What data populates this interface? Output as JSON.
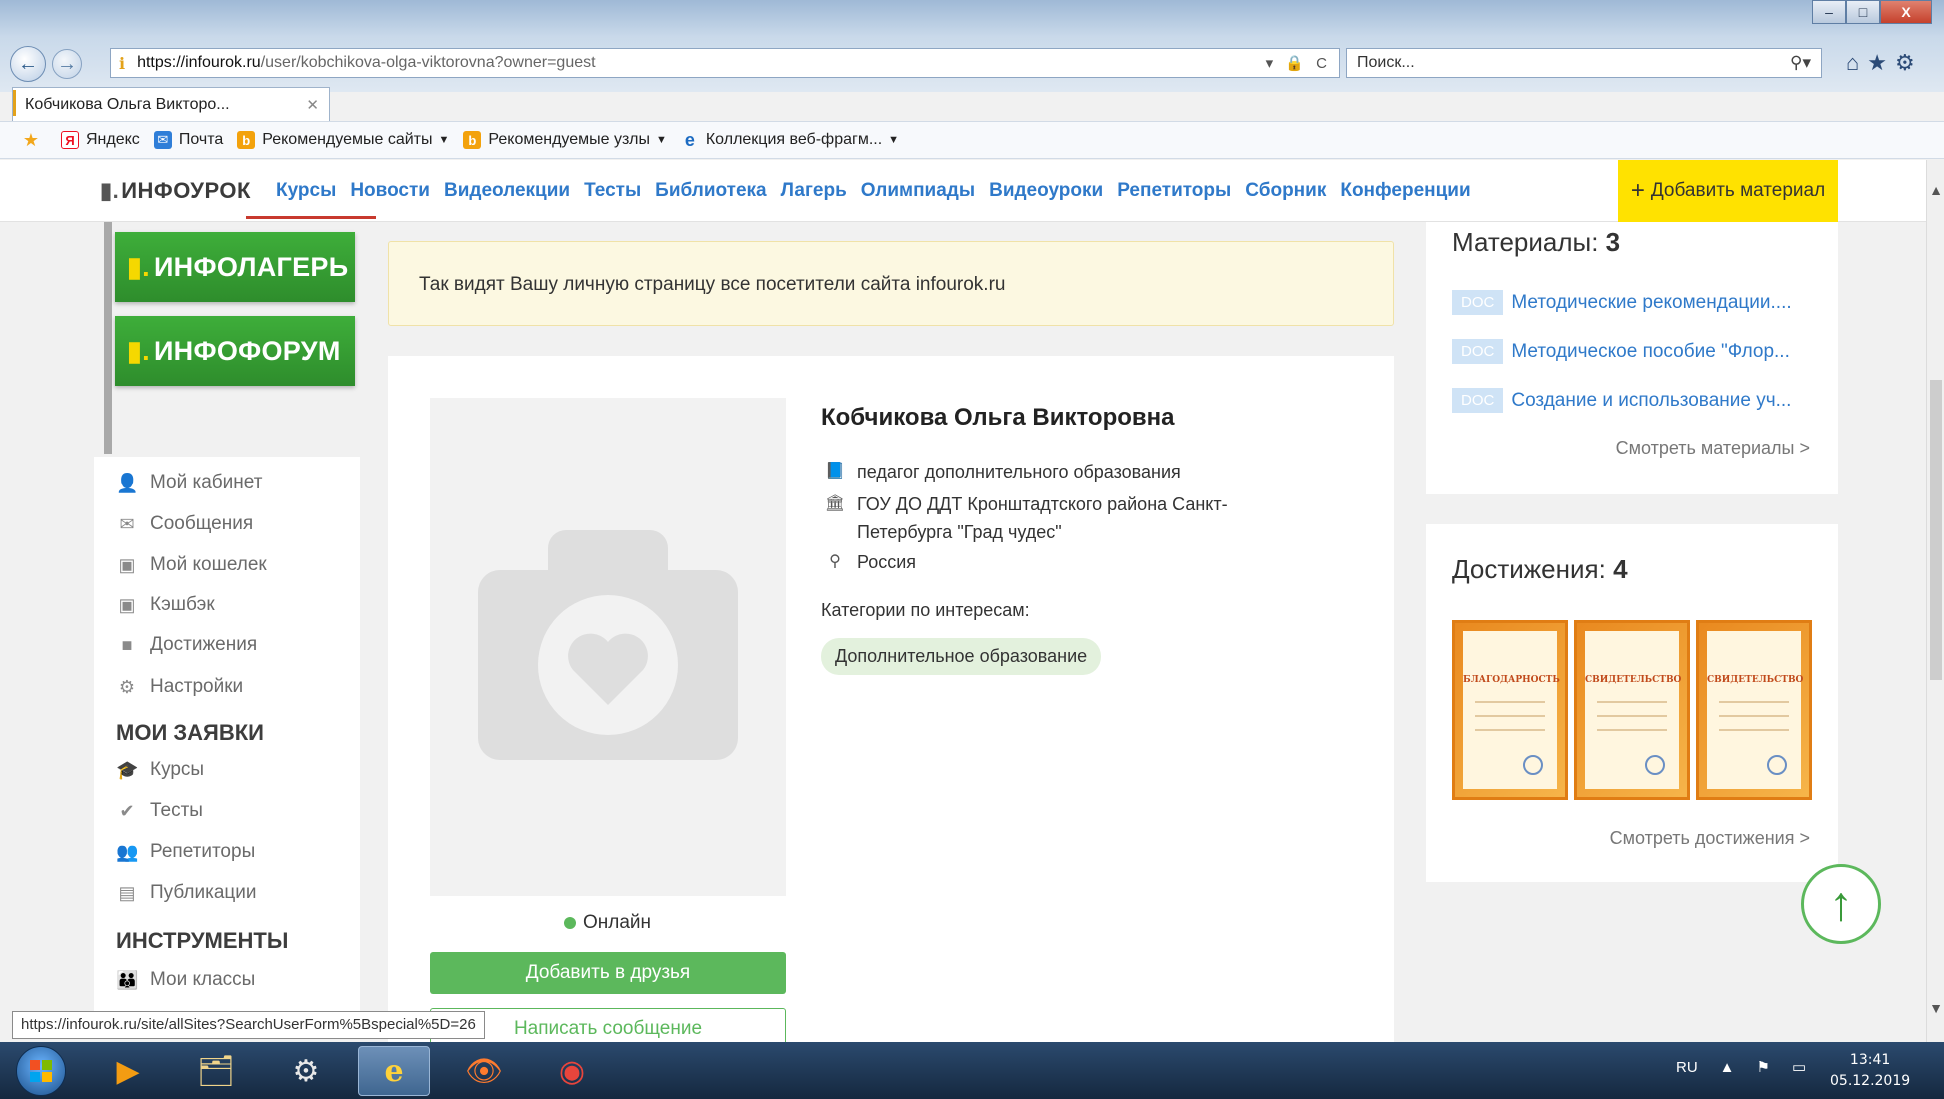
{
  "browser": {
    "url_host": "https://infourok.ru",
    "url_path": "/user/kobchikova-olga-viktorovna?owner=guest",
    "url_icons": "▾ 🔒 C",
    "search_placeholder": "Поиск...",
    "tab_title": "Кобчикова Ольга Викторо...",
    "tab_close": "✕",
    "window_controls": [
      "–",
      "□",
      "X"
    ],
    "favorites": [
      {
        "label": "",
        "icon": "favorites-star-icon",
        "caret": false
      },
      {
        "label": "Яндекс",
        "icon": "yandex-icon",
        "caret": false
      },
      {
        "label": "Почта",
        "icon": "mail-icon",
        "caret": false
      },
      {
        "label": "Рекомендуемые сайты",
        "icon": "bing-icon",
        "caret": true
      },
      {
        "label": "Рекомендуемые узлы",
        "icon": "bing-icon",
        "caret": true
      },
      {
        "label": "Коллекция веб-фрагм...",
        "icon": "ie-icon",
        "caret": true
      }
    ]
  },
  "site": {
    "logo": "ИНФОУРОК",
    "menu": [
      "Курсы",
      "Новости",
      "Видеолекции",
      "Тесты",
      "Библиотека",
      "Лагерь",
      "Олимпиады",
      "Видеоуроки",
      "Репетиторы",
      "Сборник",
      "Конференции"
    ],
    "add_material": "Добавить материал",
    "banners": [
      "ИНФОЛАГЕРЬ",
      "ИНФОФОРУМ"
    ]
  },
  "sidebar": {
    "items": [
      {
        "label": "Мой кабинет",
        "icon": "user-icon"
      },
      {
        "label": "Сообщения",
        "icon": "envelope-icon"
      },
      {
        "label": "Мой кошелек",
        "icon": "wallet-icon"
      },
      {
        "label": "Кэшбэк",
        "icon": "cashback-icon"
      },
      {
        "label": "Достижения",
        "icon": "briefcase-icon"
      },
      {
        "label": "Настройки",
        "icon": "gear-icon"
      }
    ],
    "heading_requests": "МОИ ЗАЯВКИ",
    "requests": [
      {
        "label": "Курсы",
        "icon": "graduation-cap-icon"
      },
      {
        "label": "Тесты",
        "icon": "check-circle-icon"
      },
      {
        "label": "Репетиторы",
        "icon": "tutor-icon"
      },
      {
        "label": "Публикации",
        "icon": "book-icon"
      }
    ],
    "heading_tools": "ИНСТРУМЕНТЫ",
    "tools": [
      {
        "label": "Мои классы",
        "icon": "classes-icon"
      }
    ]
  },
  "main": {
    "notice": "Так видят Вашу личную страницу все посетители сайта infourok.ru",
    "profile": {
      "name": "Кобчикова Ольга Викторовна",
      "position": "педагог дополнительного образования",
      "organization_line1": "ГОУ ДО ДДТ Кронштадтского района Санкт-",
      "organization_line2": "Петербурга \"Град чудес\"",
      "country": "Россия",
      "categories_label": "Категории по интересам:",
      "category_tag": "Дополнительное образование",
      "status": "Онлайн",
      "add_friend": "Добавить в друзья",
      "write_message": "Написать сообщение"
    }
  },
  "right": {
    "materials_title": "Материалы: ",
    "materials_count": "3",
    "materials": [
      {
        "badge": "DOC",
        "title": "Методические рекомендации...."
      },
      {
        "badge": "DOC",
        "title": "Методическое пособие \"Флор..."
      },
      {
        "badge": "DOC",
        "title": "Создание и использование уч..."
      }
    ],
    "materials_link": "Смотреть материалы >",
    "achievements_title": "Достижения: ",
    "achievements_count": "4",
    "certificates": [
      "БЛАГОДАРНОСТЬ",
      "СВИДЕТЕЛЬСТВО",
      "СВИДЕТЕЛЬСТВО"
    ],
    "achievements_link": "Смотреть достижения >"
  },
  "status_bar_url": "https://infourok.ru/site/allSites?SearchUserForm%5Bspecial%5D=26",
  "taskbar": {
    "lang": "RU",
    "time": "13:41",
    "date": "05.12.2019"
  }
}
